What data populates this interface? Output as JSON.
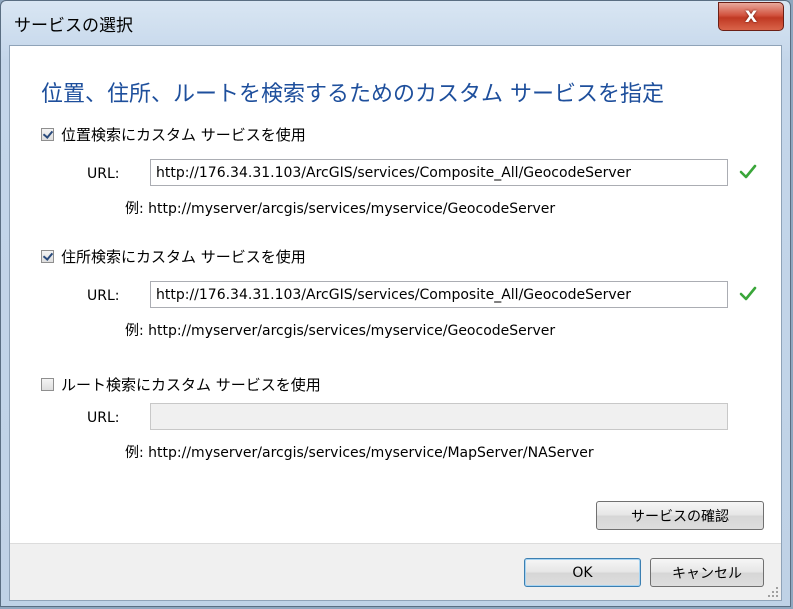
{
  "window": {
    "title": "サービスの選択",
    "close_glyph": "X"
  },
  "heading": "位置、住所、ルートを検索するためのカスタム サービスを指定",
  "sections": [
    {
      "checkbox_label": "位置検索にカスタム サービスを使用",
      "checked": true,
      "url_label": "URL:",
      "url_value": "http://176.34.31.103/ArcGIS/services/Composite_All/GeocodeServer",
      "valid_icon": "check-icon",
      "example": "例: http://myserver/arcgis/services/myservice/GeocodeServer"
    },
    {
      "checkbox_label": "住所検索にカスタム サービスを使用",
      "checked": true,
      "url_label": "URL:",
      "url_value": "http://176.34.31.103/ArcGIS/services/Composite_All/GeocodeServer",
      "valid_icon": "check-icon",
      "example": "例: http://myserver/arcgis/services/myservice/GeocodeServer"
    },
    {
      "checkbox_label": "ルート検索にカスタム サービスを使用",
      "checked": false,
      "url_label": "URL:",
      "url_value": "",
      "example": "例: http://myserver/arcgis/services/myservice/MapServer/NAServer"
    }
  ],
  "buttons": {
    "verify": "サービスの確認",
    "ok": "OK",
    "cancel": "キャンセル"
  },
  "colors": {
    "heading": "#1e4f9c",
    "check": "#3aa63a",
    "close": "#c03923"
  }
}
